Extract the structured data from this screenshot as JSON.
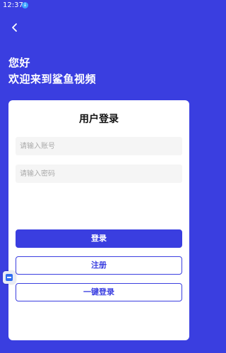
{
  "status_bar": {
    "time": "12:37",
    "notification_glyph": "↓",
    "icons": [
      "download-notification-icon"
    ]
  },
  "header": {
    "back_icon": "chevron-left-icon",
    "greeting": "您好",
    "welcome": "欢迎来到鲨鱼视频"
  },
  "card": {
    "title": "用户登录",
    "account_input": {
      "placeholder": "请输入账号",
      "value": ""
    },
    "password_input": {
      "placeholder": "请输入密码",
      "value": ""
    },
    "login_label": "登录",
    "register_label": "注册",
    "onekey_label": "一键登录"
  },
  "floating": {
    "icon": "assist-float-icon"
  },
  "colors": {
    "primary": "#3a3ee0",
    "background": "#3a3ee0",
    "card": "#ffffff",
    "input_bg": "#f5f5f5"
  }
}
